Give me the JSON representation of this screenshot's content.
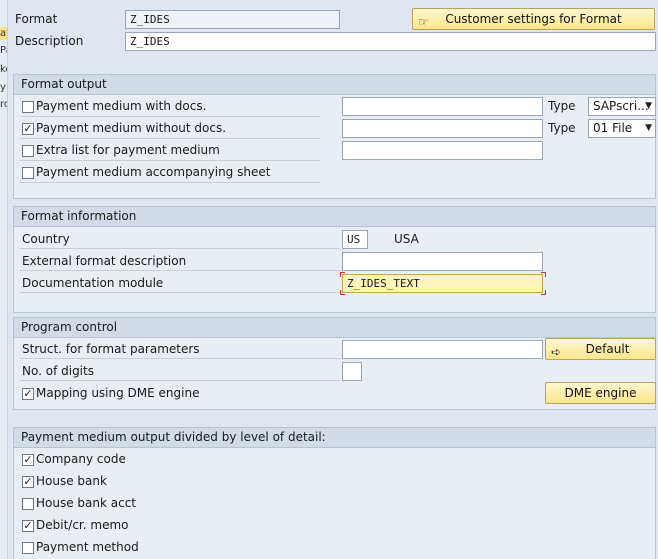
{
  "left_fragments": [
    "at",
    "Pa",
    "ke",
    "y",
    "ro"
  ],
  "header": {
    "format_label": "Format",
    "format_value": "Z_IDES",
    "description_label": "Description",
    "description_value": "Z_IDES",
    "customer_settings_button": "Customer settings for Format"
  },
  "format_output": {
    "title": "Format output",
    "rows": [
      {
        "label": "Payment medium with docs.",
        "checked": false,
        "type_label": "Type",
        "type_value": "SAPscri..."
      },
      {
        "label": "Payment medium without docs.",
        "checked": true,
        "type_label": "Type",
        "type_value": "01 File"
      },
      {
        "label": "Extra list for payment medium",
        "checked": false
      },
      {
        "label": "Payment medium accompanying sheet",
        "checked": false
      }
    ]
  },
  "format_information": {
    "title": "Format information",
    "country_label": "Country",
    "country_code": "US",
    "country_name": "USA",
    "external_label": "External format description",
    "external_value": "",
    "doc_module_label": "Documentation module",
    "doc_module_value": "Z_IDES_TEXT"
  },
  "program_control": {
    "title": "Program control",
    "struct_label": "Struct. for format parameters",
    "struct_value": "",
    "default_button": "Default",
    "digits_label": "No. of digits",
    "digits_value": "",
    "mapping_label": "Mapping using DME engine",
    "mapping_checked": true,
    "dme_button": "DME engine"
  },
  "level_of_detail": {
    "title": "Payment medium output divided by level of detail:",
    "items": [
      {
        "label": "Company code",
        "checked": true
      },
      {
        "label": "House bank",
        "checked": true
      },
      {
        "label": "House bank acct",
        "checked": false
      },
      {
        "label": "Debit/cr. memo",
        "checked": true
      },
      {
        "label": "Payment method",
        "checked": false
      }
    ]
  },
  "icons": {
    "customer_settings": "settings-hand-icon",
    "default": "arrow-right-icon",
    "dropdown": "chevron-down-icon"
  }
}
